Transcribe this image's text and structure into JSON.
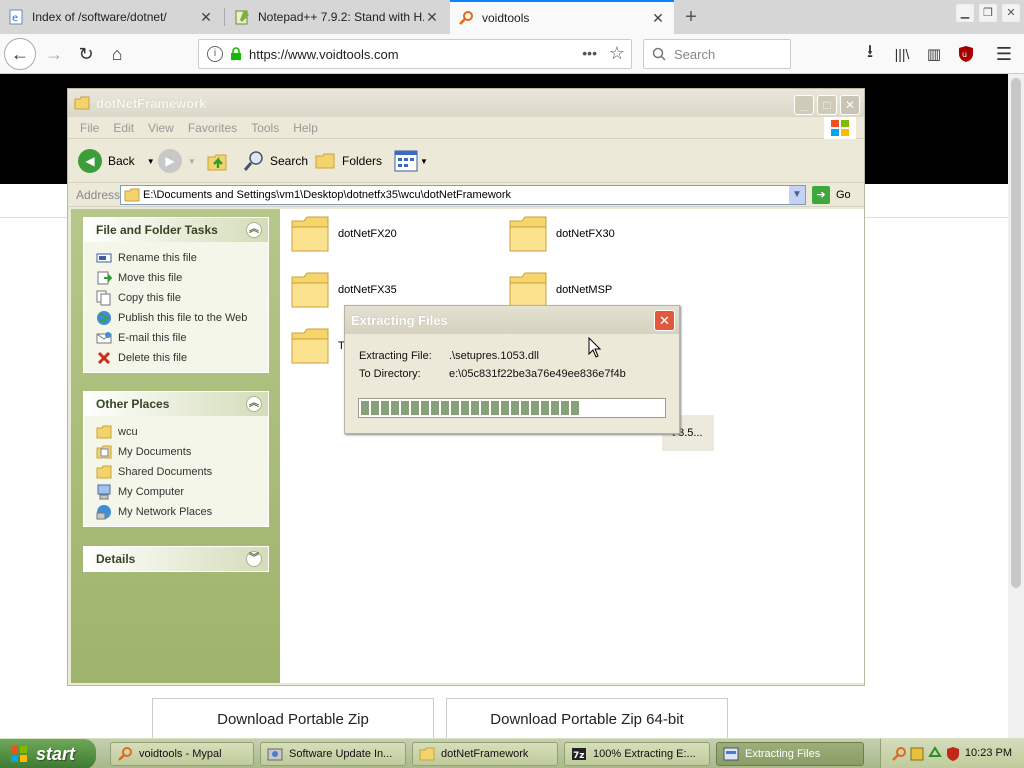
{
  "browser": {
    "tabs": [
      {
        "title": "Index of /software/dotnet/",
        "icon": "ie-page-icon"
      },
      {
        "title": "Notepad++ 7.9.2: Stand with H...",
        "icon": "notepad-icon"
      },
      {
        "title": "voidtools",
        "icon": "voidtools-search-icon"
      }
    ],
    "url": "https://www.voidtools.com",
    "search_placeholder": "Search"
  },
  "page": {
    "download_buttons": [
      "Download Portable Zip",
      "Download Portable Zip 64-bit"
    ]
  },
  "explorer": {
    "title": "dotNetFramework",
    "menu": [
      "File",
      "Edit",
      "View",
      "Favorites",
      "Tools",
      "Help"
    ],
    "toolbar": {
      "back": "Back",
      "search": "Search",
      "folders": "Folders"
    },
    "address_label": "Address",
    "address_value": "E:\\Documents and Settings\\vm1\\Desktop\\dotnetfx35\\wcu\\dotNetFramework",
    "go_label": "Go",
    "file_tasks": {
      "title": "File and Folder Tasks",
      "items": [
        "Rename this file",
        "Move this file",
        "Copy this file",
        "Publish this file to the Web",
        "E-mail this file",
        "Delete this file"
      ]
    },
    "other_places": {
      "title": "Other Places",
      "items": [
        "wcu",
        "My Documents",
        "Shared Documents",
        "My Computer",
        "My Network Places"
      ]
    },
    "details_title": "Details",
    "folders": [
      "dotNetFX20",
      "dotNetFX30",
      "dotNetFX35",
      "dotNetMSP"
    ],
    "partial_left": "T",
    "partial_right": "t 3.5..."
  },
  "dialog": {
    "title": "Extracting Files",
    "file_label": "Extracting File:",
    "file_value": ".\\setupres.1053.dll",
    "dir_label": "To Directory:",
    "dir_value": "e:\\05c831f22be3a76e49ee836e7f4b",
    "progress": 0.74
  },
  "taskbar": {
    "start_label": "start",
    "tasks": [
      "voidtools - Mypal",
      "Software Update In...",
      "dotNetFramework",
      "100% Extracting E:...",
      "Extracting Files"
    ],
    "clock": "10:23 PM"
  }
}
